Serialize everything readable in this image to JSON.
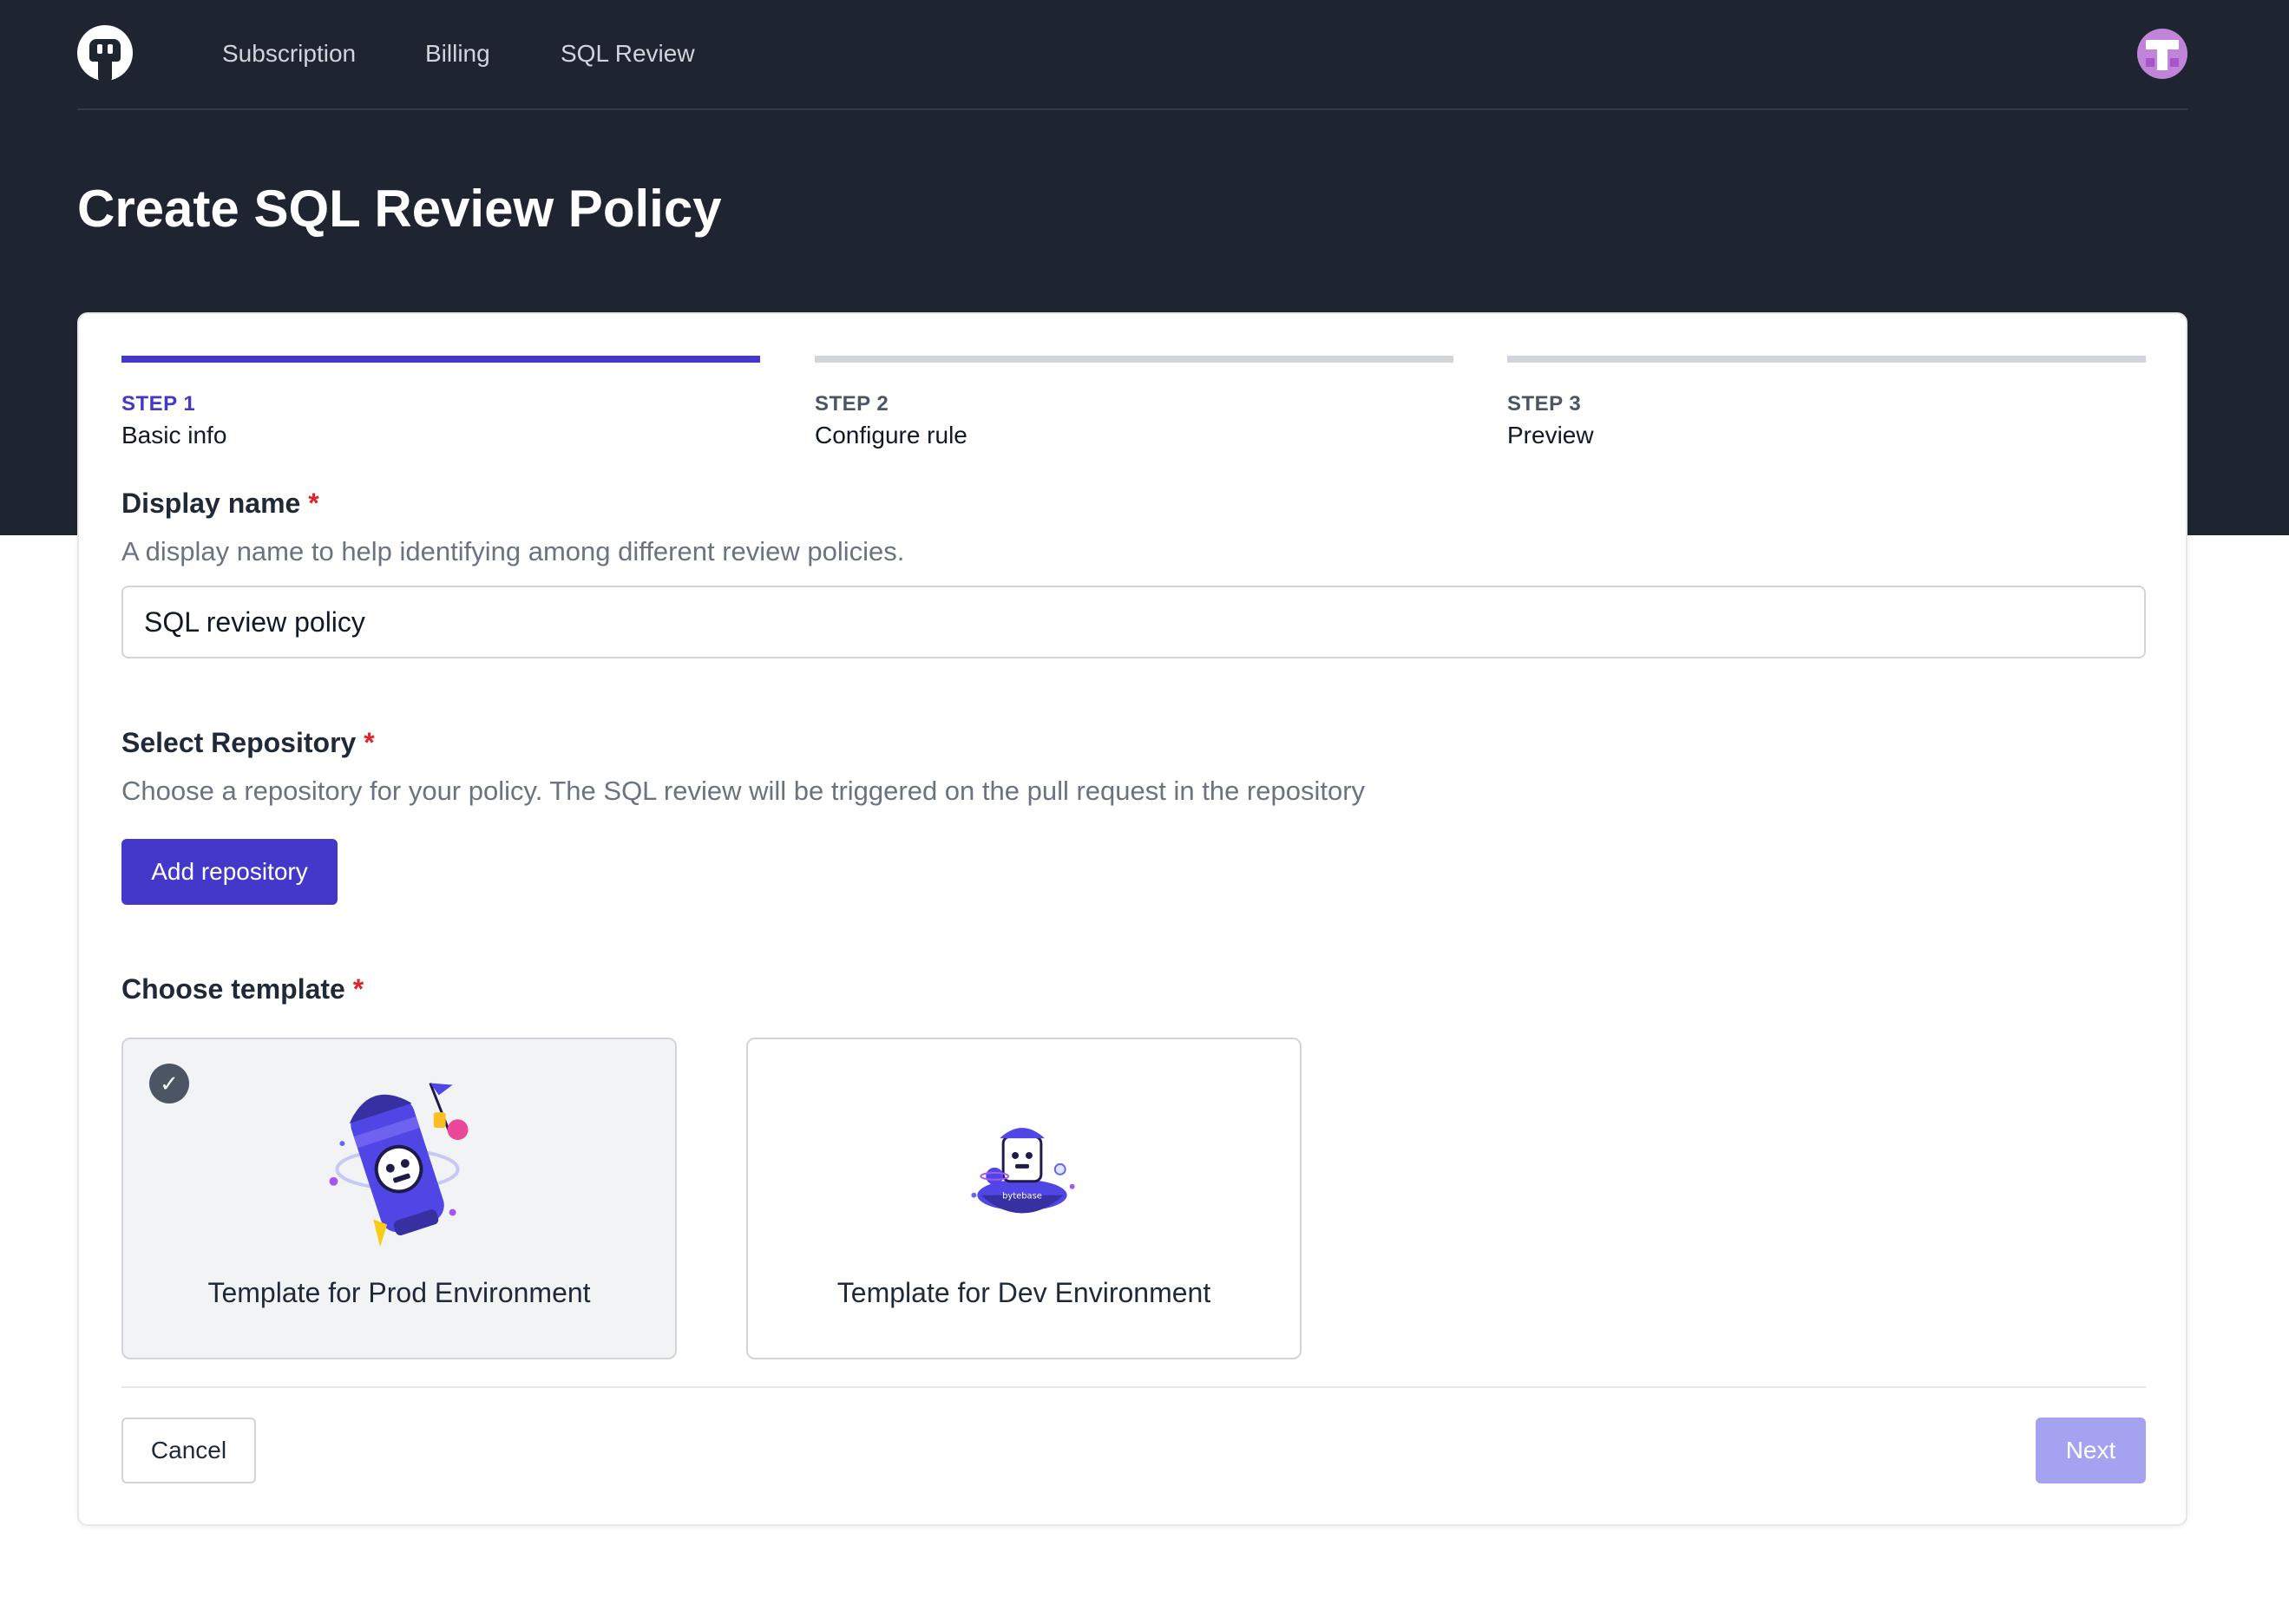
{
  "nav": {
    "logo_icon": "bytebase-logo-icon",
    "links": [
      "Subscription",
      "Billing",
      "SQL Review"
    ],
    "avatar_icon": "user-avatar-icon"
  },
  "page": {
    "title": "Create SQL Review Policy"
  },
  "steps": [
    {
      "number": "STEP 1",
      "label": "Basic info",
      "active": true
    },
    {
      "number": "STEP 2",
      "label": "Configure rule",
      "active": false
    },
    {
      "number": "STEP 3",
      "label": "Preview",
      "active": false
    }
  ],
  "form": {
    "required_mark": "*",
    "display_name": {
      "label": "Display name",
      "help": "A display name to help identifying among different review policies.",
      "value": "SQL review policy"
    },
    "repository": {
      "label": "Select Repository",
      "help": "Choose a repository for your policy. The SQL review will be triggered on the pull request in the repository",
      "button": "Add repository"
    },
    "template": {
      "label": "Choose template",
      "options": [
        {
          "label": "Template for Prod Environment",
          "selected": true,
          "icon": "prod-rocket-illustration"
        },
        {
          "label": "Template for Dev Environment",
          "selected": false,
          "icon": "dev-ufo-illustration"
        }
      ],
      "check_icon": "checkmark-icon"
    }
  },
  "footer": {
    "cancel": "Cancel",
    "next": "Next",
    "next_disabled": true
  },
  "colors": {
    "header_bg": "#1f2431",
    "accent": "#4338ca",
    "accent_disabled": "#a5a3f1",
    "required": "#dc2626"
  }
}
